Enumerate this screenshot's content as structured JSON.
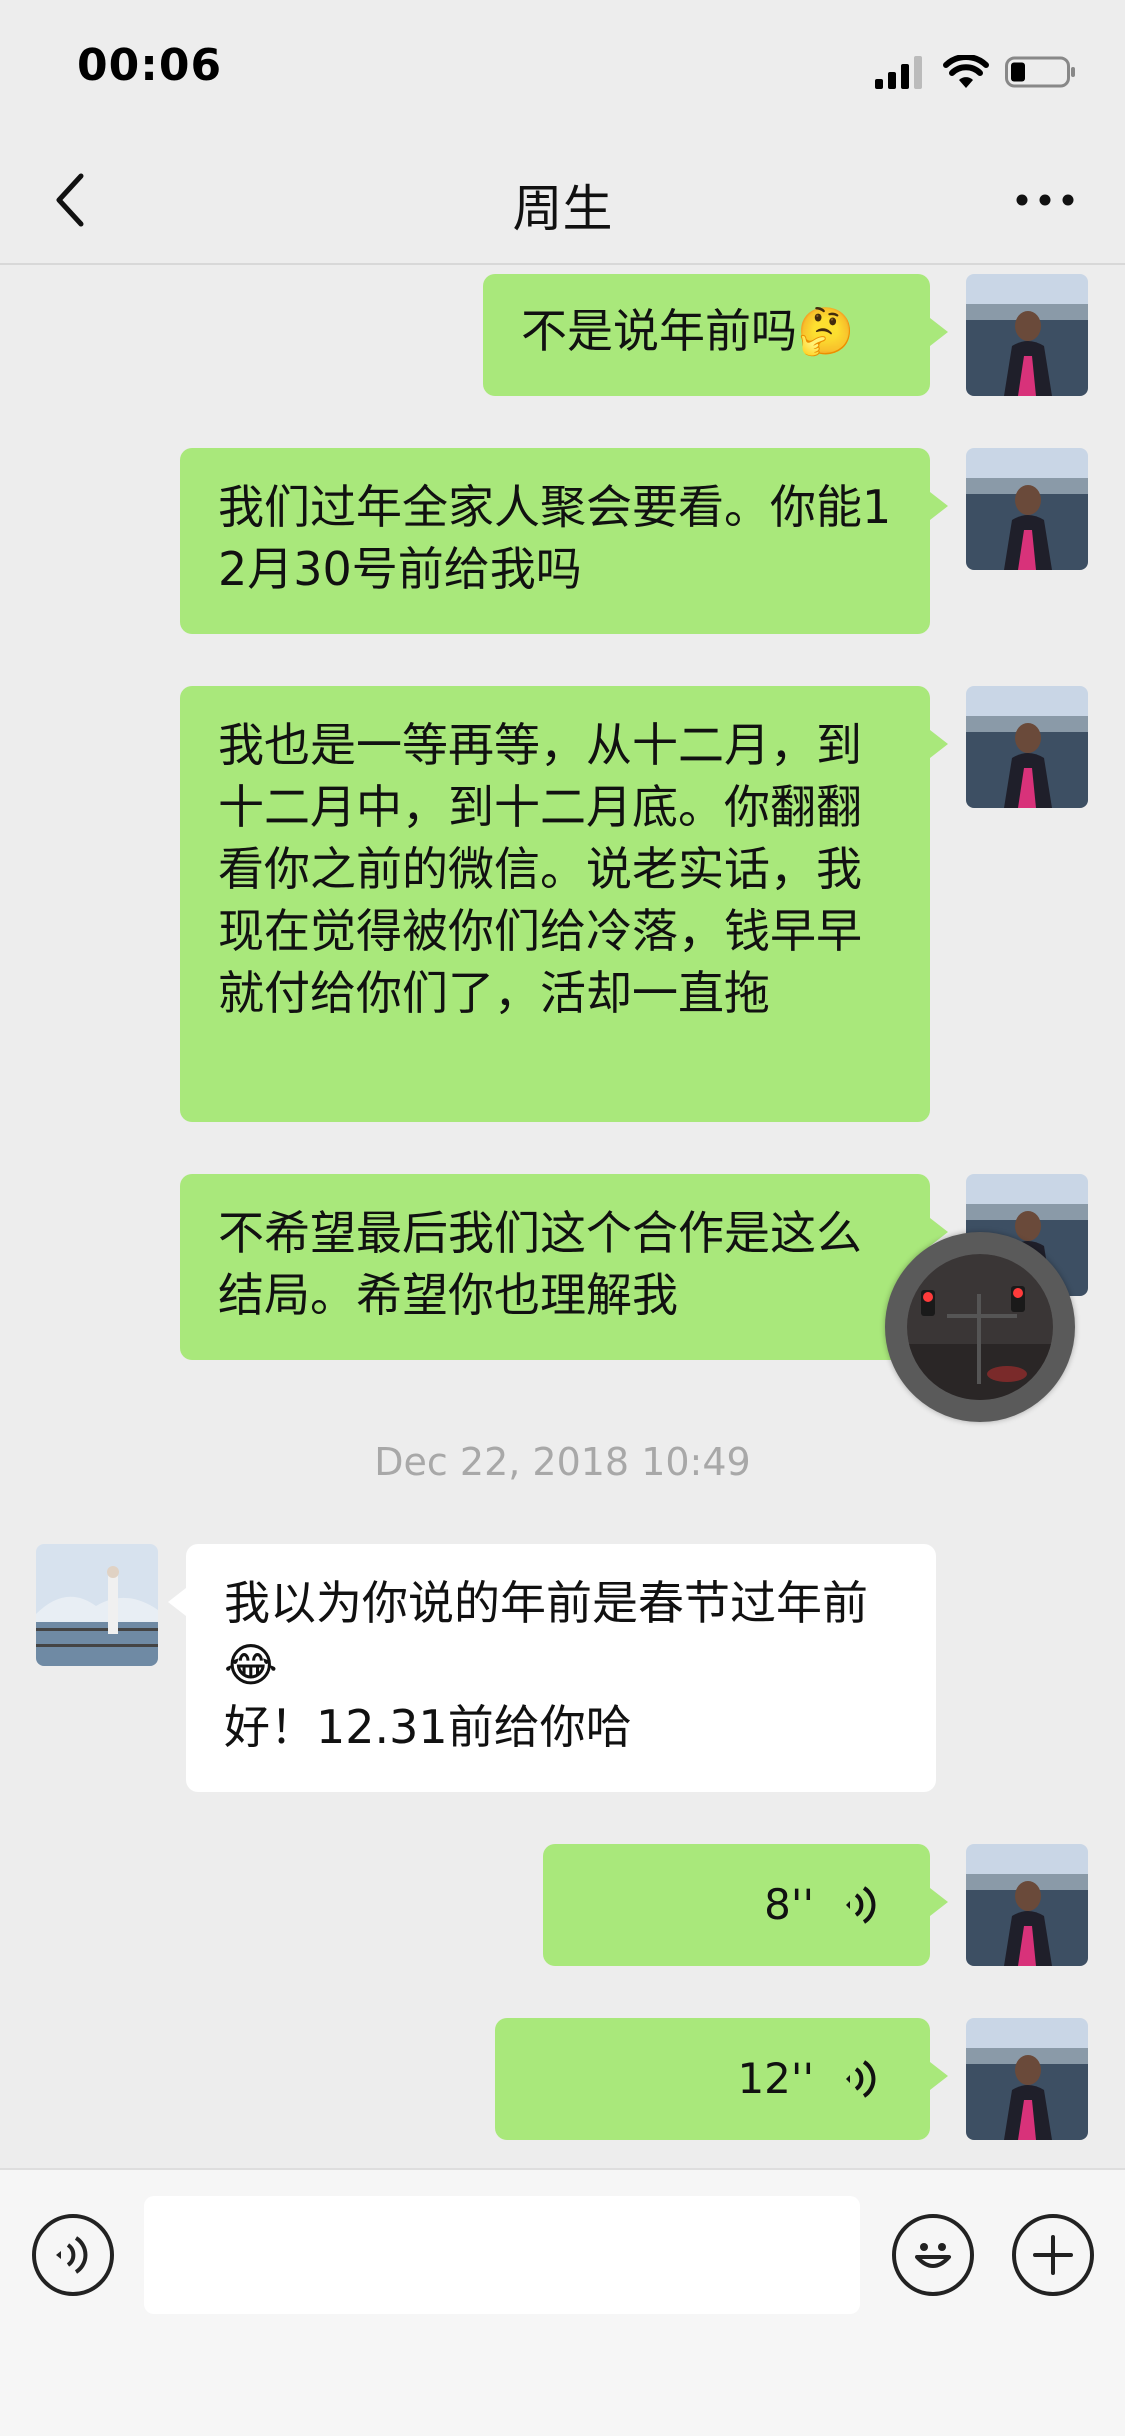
{
  "status_bar": {
    "time": "00:06",
    "icons": [
      "signal-icon",
      "wifi-icon",
      "battery-icon"
    ]
  },
  "nav": {
    "title": "周生",
    "back_icon": "chevron-left-icon",
    "more_icon": "more-dots-icon"
  },
  "messages": [
    {
      "from": "me",
      "text": "不是说年前吗🤔"
    },
    {
      "from": "me",
      "text": "我们过年全家人聚会要看。你能12月30号前给我吗"
    },
    {
      "from": "me",
      "text": "我也是一等再等，从十二月，到十二月中，到十二月底。你翻翻看你之前的微信。说老实话，我现在觉得被你们给冷落，钱早早就付给你们了，活却一直拖"
    },
    {
      "from": "me",
      "text": "不希望最后我们这个合作是这么结局。希望你也理解我"
    },
    {
      "from": "them",
      "text": "我以为你说的年前是春节过年前😂\n好！12.31前给你哈"
    },
    {
      "from": "me",
      "type": "voice",
      "duration": "8''"
    },
    {
      "from": "me",
      "type": "voice",
      "duration": "12''"
    }
  ],
  "timestamp": "Dec 22, 2018 10:49",
  "input_bar": {
    "voice_icon": "voice-input-icon",
    "emoji_icon": "emoji-icon",
    "plus_icon": "plus-icon",
    "value": ""
  },
  "colors": {
    "my_bubble": "#a9e87b",
    "their_bubble": "#ffffff",
    "background": "#ededed"
  }
}
